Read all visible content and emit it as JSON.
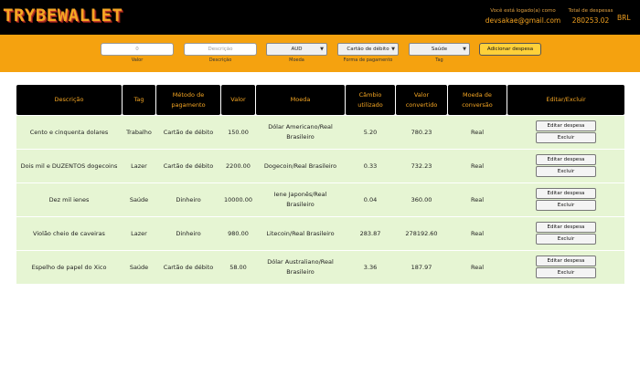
{
  "header": {
    "logo": "TRYBEWALLET",
    "login_label": "Você está logado(a) como",
    "email": "devsakae@gmail.com",
    "total_label": "Total de despesas",
    "total_value": "280253.02",
    "currency": "BRL"
  },
  "form": {
    "value_placeholder": "0",
    "value_label": "Valor",
    "description_placeholder": "Descrição",
    "description_label": "Descrição",
    "currency_selected": "AUD",
    "currency_label": "Moeda",
    "method_selected": "Cartão de débito",
    "method_label": "Forma de pagamento",
    "tag_selected": "Saúde",
    "tag_label": "Tag",
    "add_button": "Adicionar despesa"
  },
  "table": {
    "headers": [
      "Descrição",
      "Tag",
      "Método de pagamento",
      "Valor",
      "Moeda",
      "Câmbio utilizado",
      "Valor convertido",
      "Moeda de conversão",
      "Editar/Excluir"
    ],
    "edit_label": "Editar despesa",
    "delete_label": "Excluir",
    "rows": [
      {
        "description": "Cento e cinquenta dolares",
        "tag": "Trabalho",
        "method": "Cartão de débito",
        "value": "150.00",
        "currency": "Dólar Americano/Real Brasileiro",
        "rate": "5.20",
        "converted": "780.23",
        "conversion_currency": "Real"
      },
      {
        "description": "Dois mil e DUZENTOS dogecoins",
        "tag": "Lazer",
        "method": "Cartão de débito",
        "value": "2200.00",
        "currency": "Dogecoin/Real Brasileiro",
        "rate": "0.33",
        "converted": "732.23",
        "conversion_currency": "Real"
      },
      {
        "description": "Dez mil ienes",
        "tag": "Saúde",
        "method": "Dinheiro",
        "value": "10000.00",
        "currency": "Iene Japonês/Real Brasileiro",
        "rate": "0.04",
        "converted": "360.00",
        "conversion_currency": "Real"
      },
      {
        "description": "Violão cheio de caveiras",
        "tag": "Lazer",
        "method": "Dinheiro",
        "value": "980.00",
        "currency": "Litecoin/Real Brasileiro",
        "rate": "283.87",
        "converted": "278192.60",
        "conversion_currency": "Real"
      },
      {
        "description": "Espelho de papel do Xico",
        "tag": "Saúde",
        "method": "Cartão de débito",
        "value": "58.00",
        "currency": "Dólar Australiano/Real Brasileiro",
        "rate": "3.36",
        "converted": "187.97",
        "conversion_currency": "Real"
      }
    ]
  }
}
